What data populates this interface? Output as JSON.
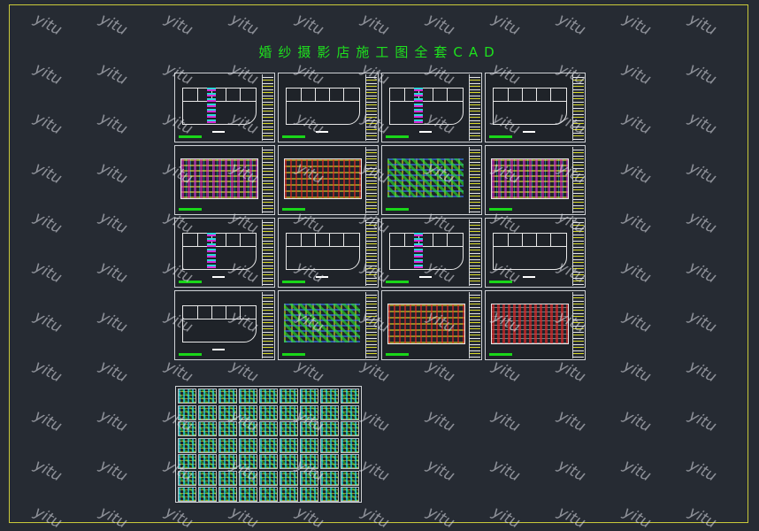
{
  "title": "婚纱摄影店施工图全套CAD",
  "watermark_text": "yitu",
  "colors": {
    "background": "#262b33",
    "frame": "#c9c93a",
    "title": "#1ee01e",
    "sheet_border": "#cfd2d6"
  },
  "sheets": {
    "rows": 4,
    "columns": 4,
    "styles": [
      [
        "plan",
        "plan",
        "plan",
        "plan"
      ],
      [
        "c1",
        "c2",
        "c3",
        "c1"
      ],
      [
        "plan",
        "plan",
        "plan",
        "plan"
      ],
      [
        "plan",
        "c3",
        "c2",
        "c4"
      ]
    ]
  },
  "thumbnails": {
    "rows": 7,
    "columns": 9
  }
}
